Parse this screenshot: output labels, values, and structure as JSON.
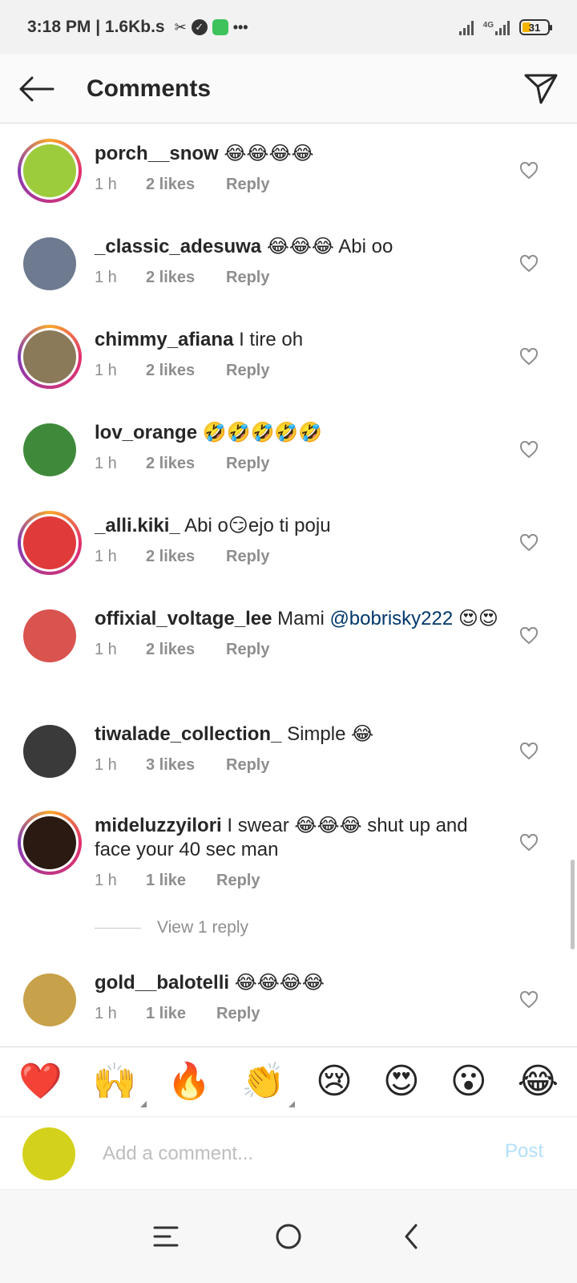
{
  "status_bar": {
    "time_speed": "3:18 PM | 1.6Kb.s",
    "network_label": "4G",
    "battery": "31",
    "more_dots": "•••"
  },
  "header": {
    "title": "Comments"
  },
  "comments": [
    {
      "username": "porch__snow",
      "text": " 😂😂😂😂",
      "mention": "",
      "time": "1 h",
      "likes": "2 likes",
      "reply": "Reply",
      "avatar_color": "#9ccc3c",
      "ring": true
    },
    {
      "username": "_classic_adesuwa",
      "text": " 😂😂😂 Abi oo",
      "mention": "",
      "time": "1 h",
      "likes": "2 likes",
      "reply": "Reply",
      "avatar_color": "#6d7a8f",
      "ring": false
    },
    {
      "username": "chimmy_afiana",
      "text": " I tire oh",
      "mention": "",
      "time": "1 h",
      "likes": "2 likes",
      "reply": "Reply",
      "avatar_color": "#8a7a5a",
      "ring": true
    },
    {
      "username": "lov_orange",
      "text": " 🤣🤣🤣🤣🤣",
      "mention": "",
      "time": "1 h",
      "likes": "2 likes",
      "reply": "Reply",
      "avatar_color": "#3f8a3a",
      "ring": false
    },
    {
      "username": "_alli.kiki_",
      "text": " Abi o😏ejo ti poju",
      "mention": "",
      "time": "1 h",
      "likes": "2 likes",
      "reply": "Reply",
      "avatar_color": "#e03a3a",
      "ring": true
    },
    {
      "username": "offixial_voltage_lee",
      "text": " Mami ",
      "mention": "@bobrisky222",
      "text_after": " 😍😍",
      "time": "1 h",
      "likes": "2 likes",
      "reply": "Reply",
      "avatar_color": "#d9534f",
      "ring": false
    },
    {
      "username": "tiwalade_collection_",
      "text": " Simple 😂",
      "mention": "",
      "time": "1 h",
      "likes": "3 likes",
      "reply": "Reply",
      "avatar_color": "#3a3a3a",
      "ring": false
    },
    {
      "username": "mideluzzyilori",
      "text": " I swear 😂😂😂 shut up and face your 40 sec man",
      "mention": "",
      "time": "1 h",
      "likes": "1 like",
      "reply": "Reply",
      "avatar_color": "#2a1a12",
      "ring": true
    },
    {
      "username": "gold__balotelli",
      "text": " 😂😂😂😂",
      "mention": "",
      "time": "1 h",
      "likes": "1 like",
      "reply": "Reply",
      "avatar_color": "#c8a24a",
      "ring": false
    }
  ],
  "view_replies": "View 1 reply",
  "emoji_bar": [
    "❤️",
    "🙌",
    "🔥",
    "👏",
    "😢",
    "😍",
    "😮",
    "😂"
  ],
  "composer": {
    "placeholder": "Add a comment...",
    "post_label": "Post",
    "avatar_color": "#d4d11c"
  }
}
